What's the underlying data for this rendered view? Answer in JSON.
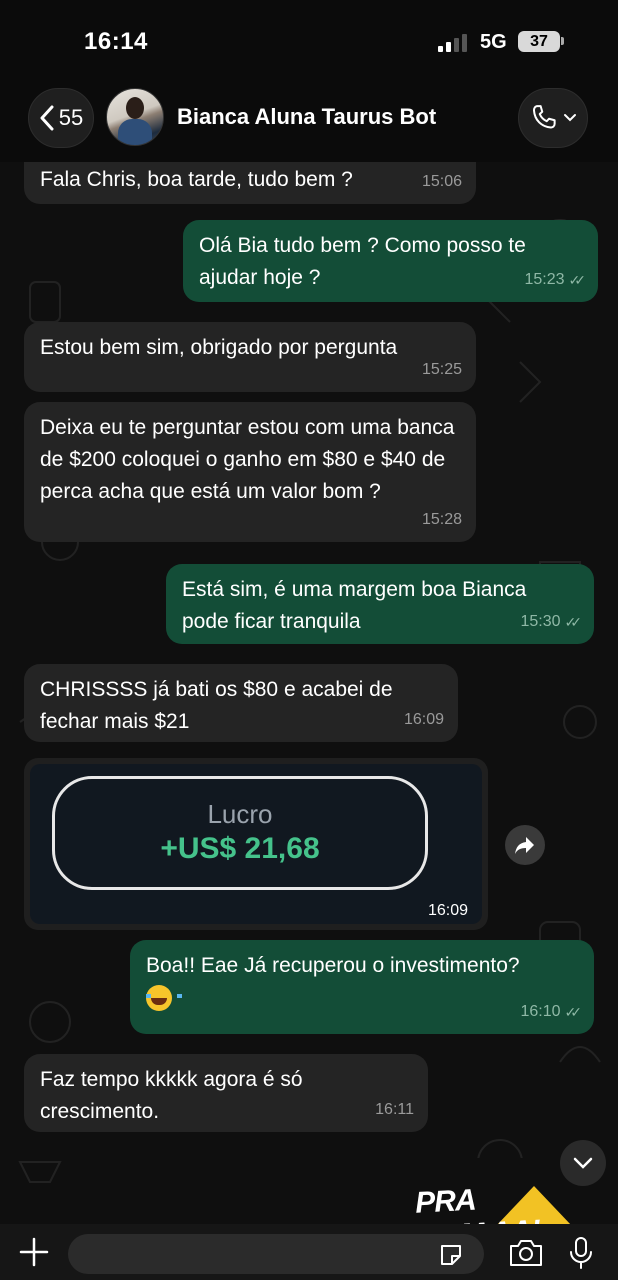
{
  "status_bar": {
    "time": "16:14",
    "network": "5G",
    "battery": "37"
  },
  "header": {
    "back_count": "55",
    "contact_name": "Bianca Aluna Taurus Bot",
    "back_icon": "chevron-left-icon",
    "call_icon": "phone-icon"
  },
  "messages": [
    {
      "direction": "in",
      "text": "Fala Chris, boa tarde, tudo bem ?",
      "time": "15:06"
    },
    {
      "direction": "out",
      "text": "Olá Bia tudo bem ? Como posso te ajudar hoje ?",
      "time": "15:23",
      "read": true
    },
    {
      "direction": "in",
      "text": "Estou bem sim, obrigado  por pergunta",
      "time": "15:25"
    },
    {
      "direction": "in",
      "text": "Deixa eu te perguntar estou com uma banca de $200  coloquei o ganho em $80 e $40 de perca acha que está um valor bom ?",
      "time": "15:28"
    },
    {
      "direction": "out",
      "text": "Está sim, é uma margem boa Bianca pode ficar tranquila",
      "time": "15:30",
      "read": true
    },
    {
      "direction": "in",
      "text": "CHRISSSS já bati os $80 e acabei de fechar mais $21",
      "time": "16:09"
    },
    {
      "direction": "in",
      "type": "image",
      "image_label": "Lucro",
      "image_value": "+US$ 21,68",
      "time": "16:09"
    },
    {
      "direction": "out",
      "text": "Boa!! Eae Já recuperou o investimento?",
      "emoji": "joy-emoji",
      "time": "16:10",
      "read": true
    },
    {
      "direction": "in",
      "text": "Faz tempo kkkkk agora é só crescimento.",
      "time": "16:11"
    }
  ],
  "sticker": {
    "text": "PRA CIMAAA!"
  },
  "colors": {
    "incoming_bubble": "#242424",
    "outgoing_bubble": "#134d37",
    "profit_green": "#45c28b",
    "background": "#0f0f0f"
  },
  "input_bar": {
    "icons": [
      "plus-icon",
      "sticker-icon",
      "camera-icon",
      "microphone-icon"
    ]
  }
}
